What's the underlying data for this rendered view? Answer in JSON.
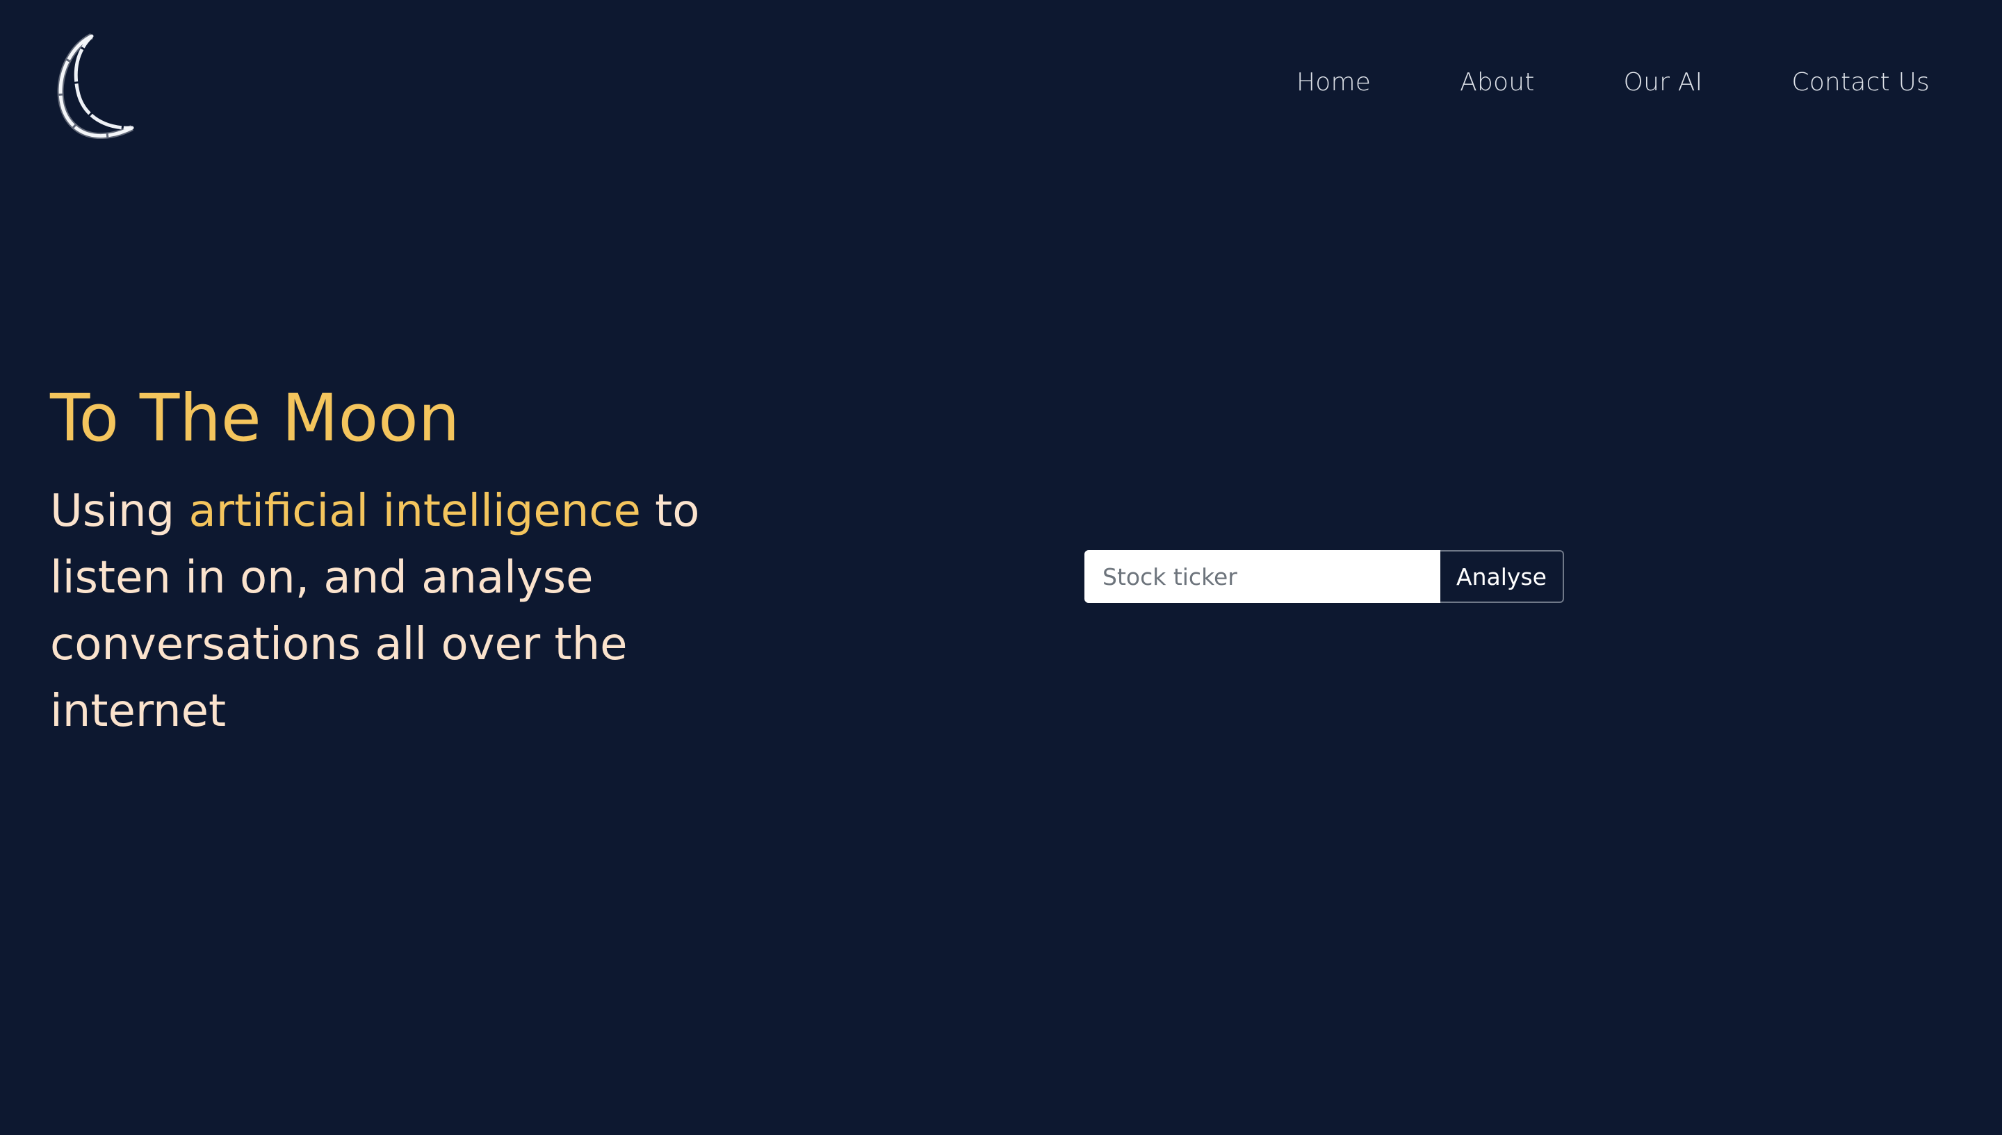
{
  "nav": {
    "items": [
      {
        "label": "Home"
      },
      {
        "label": "About"
      },
      {
        "label": "Our AI"
      },
      {
        "label": "Contact Us"
      }
    ]
  },
  "hero": {
    "title": "To The Moon",
    "subtitle_prefix": "Using ",
    "subtitle_highlight": "artificial intelligence",
    "subtitle_suffix": " to listen in on, and analyse conversations all over the internet"
  },
  "search": {
    "placeholder": "Stock ticker",
    "value": "",
    "button_label": "Analyse"
  },
  "colors": {
    "background": "#0d1830",
    "accent": "#f4c55d",
    "text_light": "#fbe3cd",
    "nav_text": "#dfe3ea"
  },
  "icons": {
    "logo": "crescent-moon-icon"
  }
}
